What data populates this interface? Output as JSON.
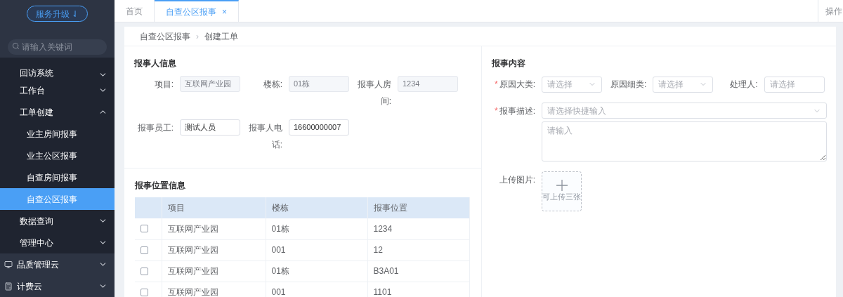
{
  "sidebar": {
    "upgrade_button": "服务升级 ⇃",
    "search": {
      "placeholder": "请输入关键词"
    },
    "menu": [
      {
        "label": "回访系统",
        "kind": "item",
        "expanded": false,
        "selected": false
      },
      {
        "label": "工作台",
        "kind": "item",
        "expanded": false,
        "selected": false
      },
      {
        "label": "工单创建",
        "kind": "item",
        "expanded": true,
        "selected": false,
        "children": [
          {
            "label": "业主房间报事",
            "selected": false
          },
          {
            "label": "业主公区报事",
            "selected": false
          },
          {
            "label": "自查房间报事",
            "selected": false
          },
          {
            "label": "自查公区报事",
            "selected": true
          }
        ]
      },
      {
        "label": "数据查询",
        "kind": "item",
        "expanded": false,
        "selected": false
      },
      {
        "label": "管理中心",
        "kind": "item",
        "expanded": false,
        "selected": false
      },
      {
        "label": "品质管理云",
        "kind": "cloud",
        "expanded": false,
        "selected": false
      },
      {
        "label": "计费云",
        "kind": "cloud",
        "expanded": false,
        "selected": false
      }
    ]
  },
  "tabs": [
    {
      "label": "首页",
      "selected": false
    },
    {
      "label": "自查公区报事",
      "selected": true,
      "close": "×"
    }
  ],
  "top_right": "操作",
  "breadcrumb": [
    "自查公区报事",
    "创建工单"
  ],
  "breadcrumb_separator": "›",
  "reporter": {
    "title": "报事人信息",
    "fields": [
      {
        "label": "项目:",
        "value": "互联网产业园",
        "disabled": true
      },
      {
        "label": "楼栋:",
        "value": "01栋",
        "disabled": true
      },
      {
        "label": "报事人房间:",
        "value": "1234",
        "disabled": true
      },
      {
        "label": "报事员工:",
        "value": "测试人员",
        "disabled": false
      },
      {
        "label": "报事人电话:",
        "value": "16600000007",
        "disabled": false
      }
    ]
  },
  "location": {
    "title": "报事位置信息",
    "columns": [
      "项目",
      "楼栋",
      "报事位置"
    ],
    "rows": [
      {
        "checked": false,
        "cells": [
          "互联网产业园",
          "01栋",
          "1234"
        ]
      },
      {
        "checked": false,
        "cells": [
          "互联网产业园",
          "001",
          "12"
        ]
      },
      {
        "checked": false,
        "cells": [
          "互联网产业园",
          "01栋",
          "B3A01"
        ]
      },
      {
        "checked": false,
        "cells": [
          "互联网产业园",
          "001",
          "1101"
        ]
      }
    ]
  },
  "content": {
    "title": "报事内容",
    "required_mark": "*",
    "fields": [
      {
        "label": "原因大类:",
        "required": true,
        "kind": "select",
        "placeholder": "请选择"
      },
      {
        "label": "原因细类:",
        "required": false,
        "kind": "select",
        "placeholder": "请选择"
      },
      {
        "label": "处理人:",
        "required": false,
        "kind": "input",
        "placeholder": "请选择"
      }
    ],
    "description": {
      "label": "报事描述:",
      "required": true,
      "placeholder": "请选择快捷输入",
      "textarea_placeholder": "请输入"
    },
    "upload": {
      "label": "上传图片:",
      "hint": "可上传三张"
    }
  }
}
